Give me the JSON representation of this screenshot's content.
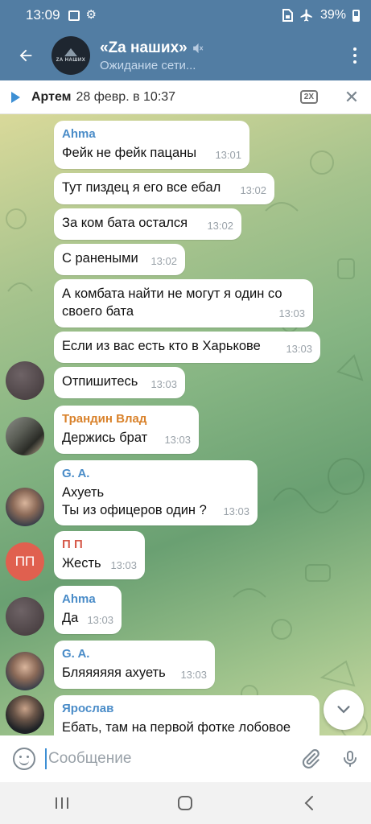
{
  "status_bar": {
    "time": "13:09",
    "battery": "39%"
  },
  "header": {
    "title": "«Za наших»",
    "status": "Ожидание сети...",
    "avatar_text": "ZA НАШИХ"
  },
  "audio_bar": {
    "name": "Артем",
    "date": "28 февр. в 10:37",
    "speed": "2X"
  },
  "messages": [
    {
      "sender": "Ahma",
      "text": "Фейк не фейк пацаны",
      "time": "13:01"
    },
    {
      "text": "Тут пиздец я его все ебал",
      "time": "13:02"
    },
    {
      "text": "За ком бата остался",
      "time": "13:02"
    },
    {
      "text": "С ранеными",
      "time": "13:02"
    },
    {
      "text": "А комбата найти не могут я один со\nсвоего бата",
      "time": "13:03"
    },
    {
      "text": "Если из вас есть кто в Харькове",
      "time": "13:03"
    },
    {
      "text": "Отпишитесь",
      "time": "13:03"
    },
    {
      "sender": "Трандин Влад",
      "text": "Держись брат",
      "time": "13:03"
    },
    {
      "sender": "G. A.",
      "text": "Ахуеть\nТы из офицеров один ?",
      "time": "13:03"
    },
    {
      "sender": "П П",
      "text": "Жесть",
      "time": "13:03"
    },
    {
      "sender": "Ahma",
      "text": "Да",
      "time": "13:03"
    },
    {
      "sender": "G. A.",
      "text": "Бляяяяяя ахуеть",
      "time": "13:03"
    },
    {
      "sender": "Ярослав",
      "text": "Ебать, там на первой фотке лобовое"
    }
  ],
  "avatars": {
    "pp_initials": "ПП"
  },
  "input": {
    "placeholder": "Сообщение"
  },
  "colors": {
    "header_bg": "#527da3",
    "sender_ahma": "#4a8cc8",
    "sender_vlad": "#d9822b",
    "sender_ga": "#4a8cc8",
    "sender_pp": "#d65a4a",
    "sender_yaroslav": "#4a8cc8",
    "pp_avatar": "#e0604f"
  }
}
